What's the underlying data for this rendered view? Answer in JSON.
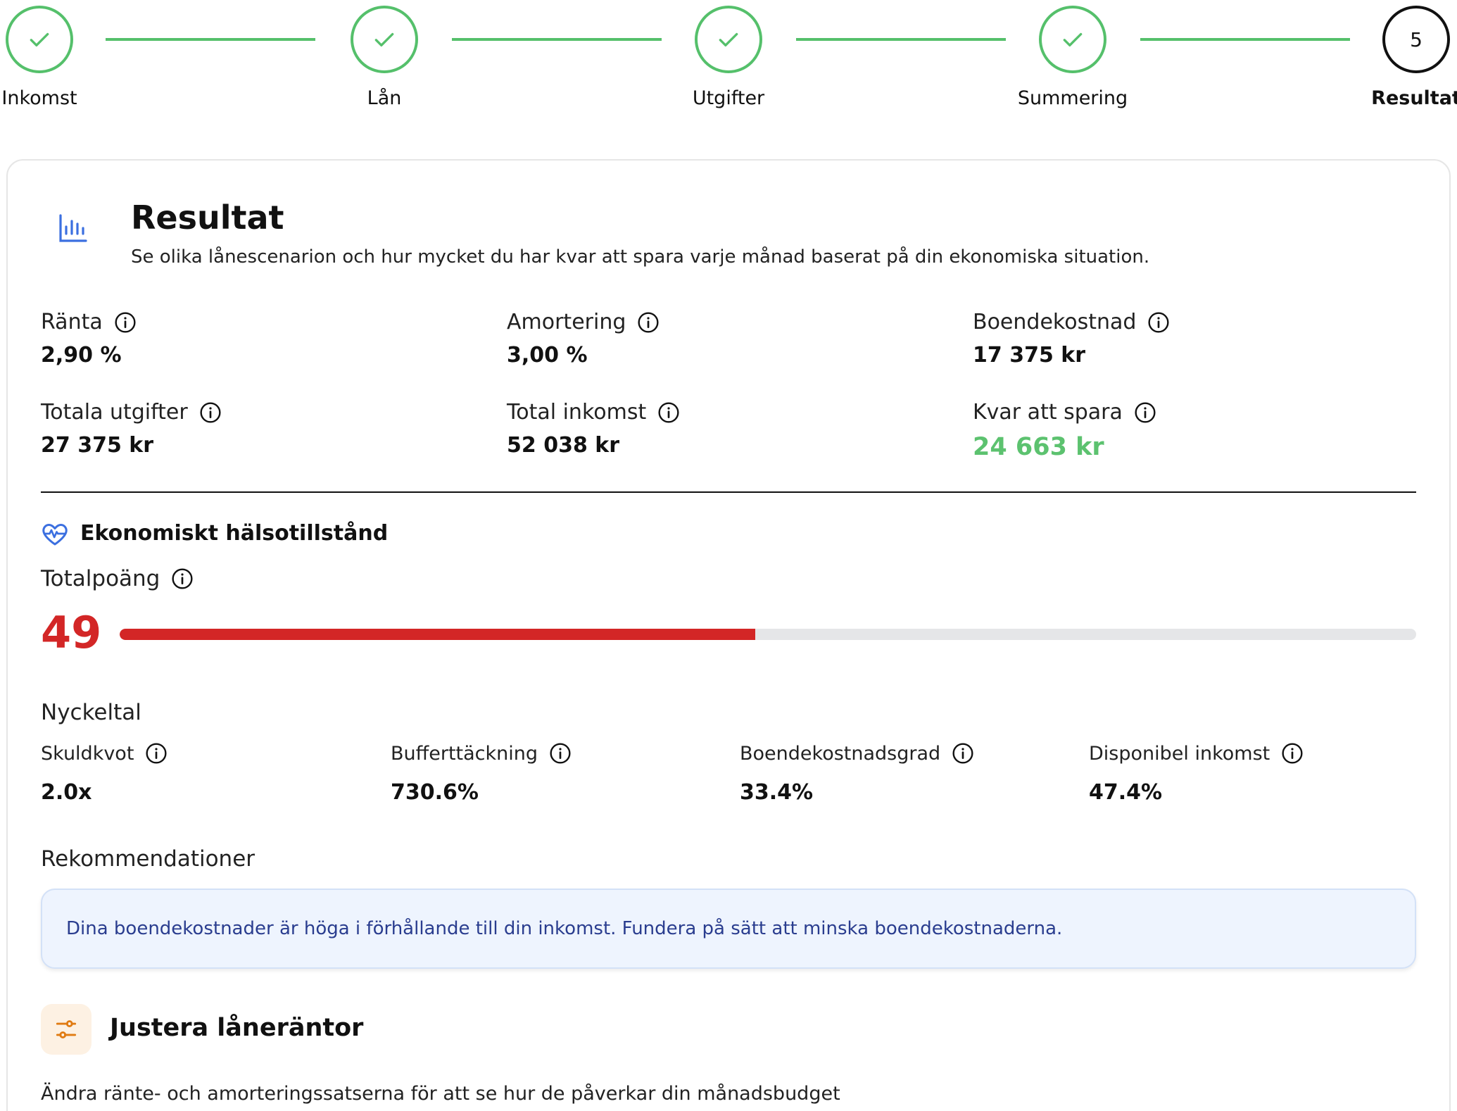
{
  "stepper": {
    "steps": [
      {
        "label": "Inkomst",
        "status": "done"
      },
      {
        "label": "Lån",
        "status": "done"
      },
      {
        "label": "Utgifter",
        "status": "done"
      },
      {
        "label": "Summering",
        "status": "done"
      },
      {
        "label": "Resultat",
        "status": "current",
        "number": "5"
      }
    ]
  },
  "result": {
    "title": "Resultat",
    "subtitle": "Se olika lånescenarion och hur mycket du har kvar att spara varje månad baserat på din ekonomiska situation."
  },
  "metrics": [
    {
      "label": "Ränta",
      "value": "2,90 %"
    },
    {
      "label": "Amortering",
      "value": "3,00 %"
    },
    {
      "label": "Boendekostnad",
      "value": "17 375 kr"
    },
    {
      "label": "Totala utgifter",
      "value": "27 375 kr"
    },
    {
      "label": "Total inkomst",
      "value": "52 038 kr"
    },
    {
      "label": "Kvar att spara",
      "value": "24 663 kr",
      "highlight_color": "#5cc26f"
    }
  ],
  "health": {
    "title": "Ekonomiskt hälsotillstånd",
    "total_label": "Totalpoäng",
    "score": "49",
    "score_fraction": 0.49,
    "score_color": "#d32626"
  },
  "kpis": {
    "title": "Nyckeltal",
    "items": [
      {
        "label": "Skuldkvot",
        "value": "2.0x"
      },
      {
        "label": "Bufferttäckning",
        "value": "730.6%"
      },
      {
        "label": "Boendekostnadsgrad",
        "value": "33.4%"
      },
      {
        "label": "Disponibel inkomst",
        "value": "47.4%"
      }
    ]
  },
  "recommendations": {
    "title": "Rekommendationer",
    "items": [
      "Dina boendekostnader är höga i förhållande till din inkomst. Fundera på sätt att minska boendekostnaderna."
    ]
  },
  "adjust": {
    "title": "Justera låneräntor",
    "subtitle": "Ändra ränte- och amorteringssatserna för att se hur de påverkar din månadsbudget"
  },
  "icons": {
    "step_done": "check-icon",
    "result": "bar-chart-icon",
    "info": "info-icon",
    "health": "heart-pulse-icon",
    "adjust": "sliders-icon"
  },
  "colors": {
    "accent_green": "#55c06b",
    "score_red": "#d32626",
    "rec_text": "#2a3d8f",
    "rec_bg": "#eef4fe"
  }
}
